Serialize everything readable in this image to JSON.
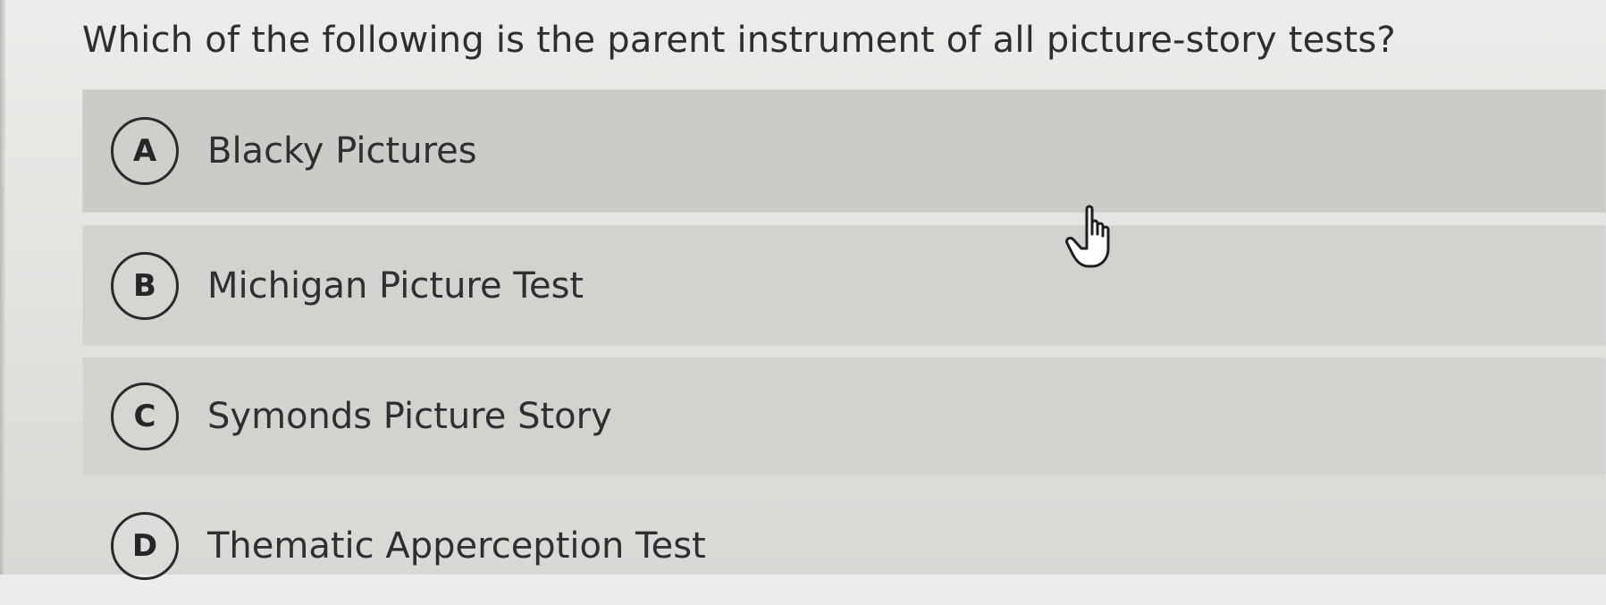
{
  "question": {
    "text": "Which of the following is the parent instrument of all picture-story tests?"
  },
  "options": [
    {
      "letter": "A",
      "label": "Blacky Pictures"
    },
    {
      "letter": "B",
      "label": "Michigan Picture Test"
    },
    {
      "letter": "C",
      "label": "Symonds Picture Story"
    },
    {
      "letter": "D",
      "label": "Thematic Apperception Test"
    }
  ],
  "cursor": {
    "icon": "hand-pointer-icon"
  },
  "colors": {
    "background": "#e4e4e1",
    "option_band": "#d1d3cf",
    "text": "#2f2f2f"
  }
}
